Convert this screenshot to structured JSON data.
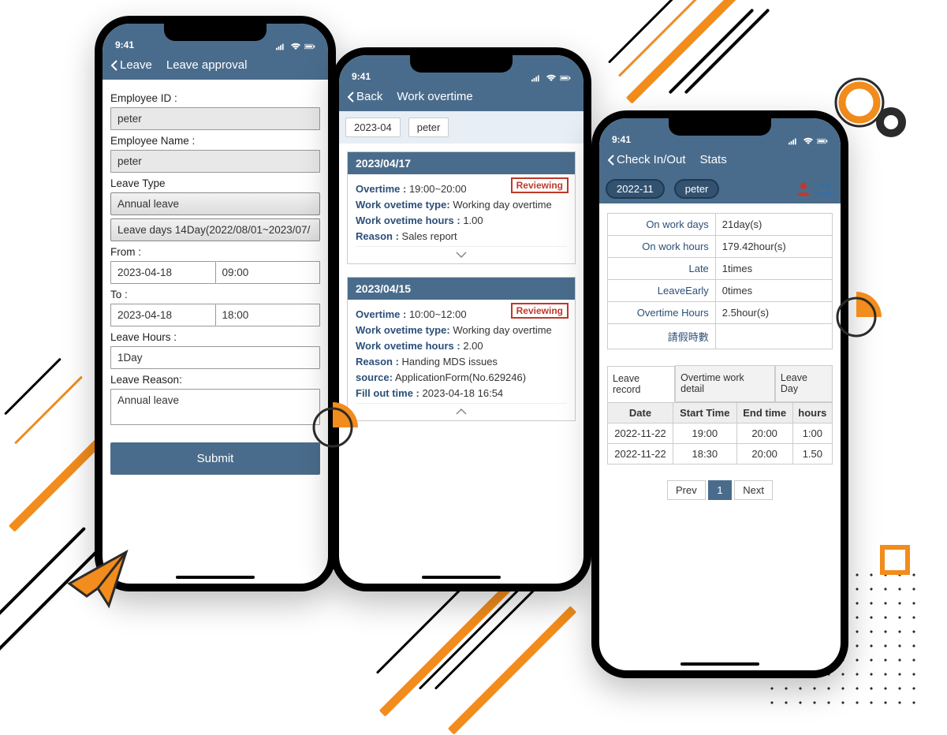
{
  "status_time": "9:41",
  "phone1": {
    "nav_back": "Leave",
    "nav_title": "Leave approval",
    "labels": {
      "emp_id": "Employee ID :",
      "emp_name": "Employee Name :",
      "leave_type": "Leave Type",
      "from": "From :",
      "to": "To :",
      "hours": "Leave Hours :",
      "reason": "Leave Reason:"
    },
    "values": {
      "emp_id": "peter",
      "emp_name": "peter",
      "leave_type": "Annual leave",
      "leave_days_desc": "Leave days 14Day(2022/08/01~2023/07/",
      "from_date": "2023-04-18",
      "from_time": "09:00",
      "to_date": "2023-04-18",
      "to_time": "18:00",
      "hours": "1Day",
      "reason": "Annual leave"
    },
    "submit": "Submit"
  },
  "phone2": {
    "nav_back": "Back",
    "nav_title": "Work overtime",
    "filter_month": "2023-04",
    "filter_name": "peter",
    "card1": {
      "date": "2023/04/17",
      "status": "Reviewing",
      "overtime_label": "Overtime :",
      "overtime_val": "19:00~20:00",
      "type_label": "Work ovetime type:",
      "type_val": "Working day overtime",
      "hours_label": "Work ovetime hours :",
      "hours_val": "1.00",
      "reason_label": "Reason :",
      "reason_val": "Sales report"
    },
    "card2": {
      "date": "2023/04/15",
      "status": "Reviewing",
      "overtime_label": "Overtime :",
      "overtime_val": "10:00~12:00",
      "type_label": "Work ovetime type:",
      "type_val": "Working day overtime",
      "hours_label": "Work ovetime hours :",
      "hours_val": "2.00",
      "reason_label": "Reason :",
      "reason_val": "Handing MDS issues",
      "source_label": "source:",
      "source_val": "ApplicationForm(No.629246)",
      "fill_label": "Fill out time :",
      "fill_val": "2023-04-18 16:54"
    }
  },
  "phone3": {
    "nav_back": "Check In/Out",
    "nav_title": "Stats",
    "filter_month": "2022-11",
    "filter_name": "peter",
    "stats": {
      "on_work_days_k": "On work days",
      "on_work_days_v": "21day(s)",
      "on_work_hours_k": "On work hours",
      "on_work_hours_v": "179.42hour(s)",
      "late_k": "Late",
      "late_v": "1times",
      "early_k": "LeaveEarly",
      "early_v": "0times",
      "ot_k": "Overtime Hours",
      "ot_v": "2.5hour(s)",
      "leave_hours_k": "請假時數",
      "leave_hours_v": ""
    },
    "tabs": {
      "t1": "Leave record",
      "t2": "Overtime work detail",
      "t3": "Leave Day"
    },
    "table": {
      "h_date": "Date",
      "h_start": "Start Time",
      "h_end": "End time",
      "h_hours": "hours",
      "rows": [
        {
          "date": "2022-11-22",
          "start": "19:00",
          "end": "20:00",
          "hours": "1:00"
        },
        {
          "date": "2022-11-22",
          "start": "18:30",
          "end": "20:00",
          "hours": "1.50"
        }
      ]
    },
    "pager": {
      "prev": "Prev",
      "page": "1",
      "next": "Next"
    }
  }
}
